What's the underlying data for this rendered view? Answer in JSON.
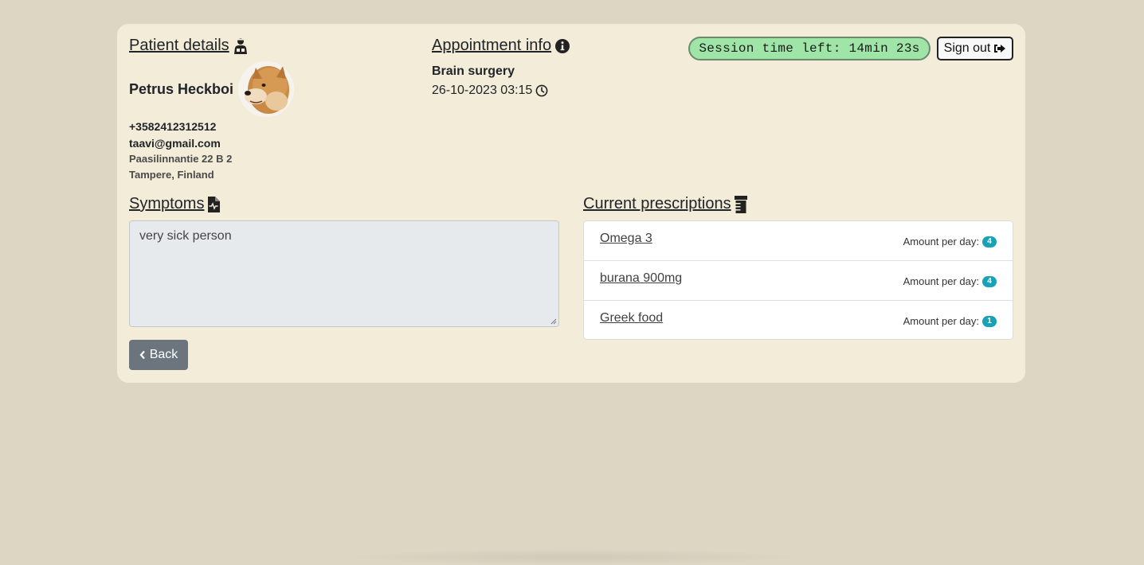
{
  "patient": {
    "section_title": "Patient details",
    "name": "Petrus Heckboi",
    "phone": "+3582412312512",
    "email": "taavi@gmail.com",
    "address": "Paasilinnantie 22 B 2",
    "city": "Tampere, Finland"
  },
  "appointment": {
    "section_title": "Appointment info",
    "type": "Brain surgery",
    "datetime": "26-10-2023 03:15"
  },
  "session": {
    "timer_text": "Session time left: 14min 23s",
    "signout_label": "Sign out"
  },
  "symptoms": {
    "section_title": "Symptoms",
    "text": "very sick person"
  },
  "prescriptions": {
    "section_title": "Current prescriptions",
    "amount_label": "Amount per day:",
    "items": [
      {
        "name": "Omega 3",
        "amount": "4"
      },
      {
        "name": "burana 900mg",
        "amount": "4"
      },
      {
        "name": "Greek food",
        "amount": "1"
      }
    ]
  },
  "back_label": "Back",
  "colors": {
    "page_bg": "#ddd6c3",
    "card_bg": "#f2ecd8",
    "session_pill": "#9ee5a7",
    "badge": "#17a2b8",
    "back_button": "#6c757d"
  },
  "icons": {
    "patient": "user-injured-icon",
    "appointment": "info-circle-icon",
    "clock": "clock-icon",
    "signout": "sign-out-icon",
    "symptoms": "file-medical-icon",
    "prescriptions": "prescription-bottle-icon",
    "back": "chevron-left-icon"
  }
}
